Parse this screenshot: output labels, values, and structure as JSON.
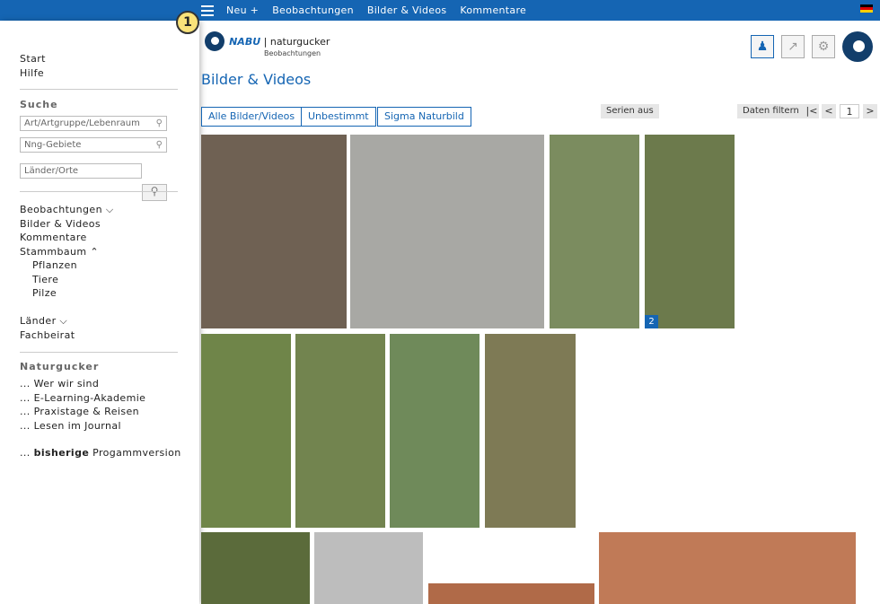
{
  "topnav": {
    "items": [
      "Neu +",
      "Beobachtungen",
      "Bilder & Videos",
      "Kommentare"
    ]
  },
  "badge": "1",
  "sidebar": {
    "nav1": [
      "Start",
      "Hilfe"
    ],
    "search_heading": "Suche",
    "search_placeholders": [
      "Art/Artgruppe/Lebenraum",
      "Nng-Gebiete",
      "Länder/Orte"
    ],
    "nav2": [
      "Beobachtungen ⌵",
      "Bilder & Videos",
      "Kommentare",
      "Stammbaum ⌃"
    ],
    "stammbaum_children": [
      "Pflanzen",
      "Tiere",
      "Pilze"
    ],
    "nav3": [
      "Länder ⌵",
      "Fachbeirat"
    ],
    "naturgucker_heading": "Naturgucker",
    "naturgucker_links": [
      "... Wer wir sind",
      "... E-Learning-Akademie",
      "... Praxistage & Reisen",
      "... Lesen im Journal"
    ],
    "version_prefix": "... ",
    "version_bold": "bisherige",
    "version_rest": " Progammversion"
  },
  "logo": {
    "brand": "NABU",
    "name": "naturgucker",
    "sub": "Beobachtungen"
  },
  "page_title": "Bilder & Videos",
  "filters": [
    "Alle Bilder/Videos",
    "Unbestimmt",
    "Sigma Naturbild"
  ],
  "series_button": "Serien aus",
  "filter_data_button": "Daten filtern",
  "pager": {
    "first": "|<",
    "prev": "<",
    "page": "1",
    "next": ">"
  },
  "tiles": [
    {
      "name": "photo-mushroom",
      "color": "#6f6153"
    },
    {
      "name": "photo-ant",
      "color": "#a8a8a4"
    },
    {
      "name": "photo-bee-flowers",
      "color": "#7b8c5f"
    },
    {
      "name": "photo-blue-butterfly",
      "color": "#6c7a4c",
      "count": "2"
    },
    {
      "name": "photo-grass-butterfly",
      "color": "#6f8549"
    },
    {
      "name": "photo-moth-leaves",
      "color": "#72844f"
    },
    {
      "name": "photo-beetle-plant",
      "color": "#6f8a5a"
    },
    {
      "name": "photo-coneflower",
      "color": "#7e7a55"
    },
    {
      "name": "photo-red-berries",
      "color": "#5b6b3b"
    },
    {
      "name": "photo-grey-wall",
      "color": "#bdbdbd"
    },
    {
      "name": "photo-brick-small",
      "color": "#b06a48"
    },
    {
      "name": "photo-brick-wasp",
      "color": "#c07a57"
    }
  ]
}
